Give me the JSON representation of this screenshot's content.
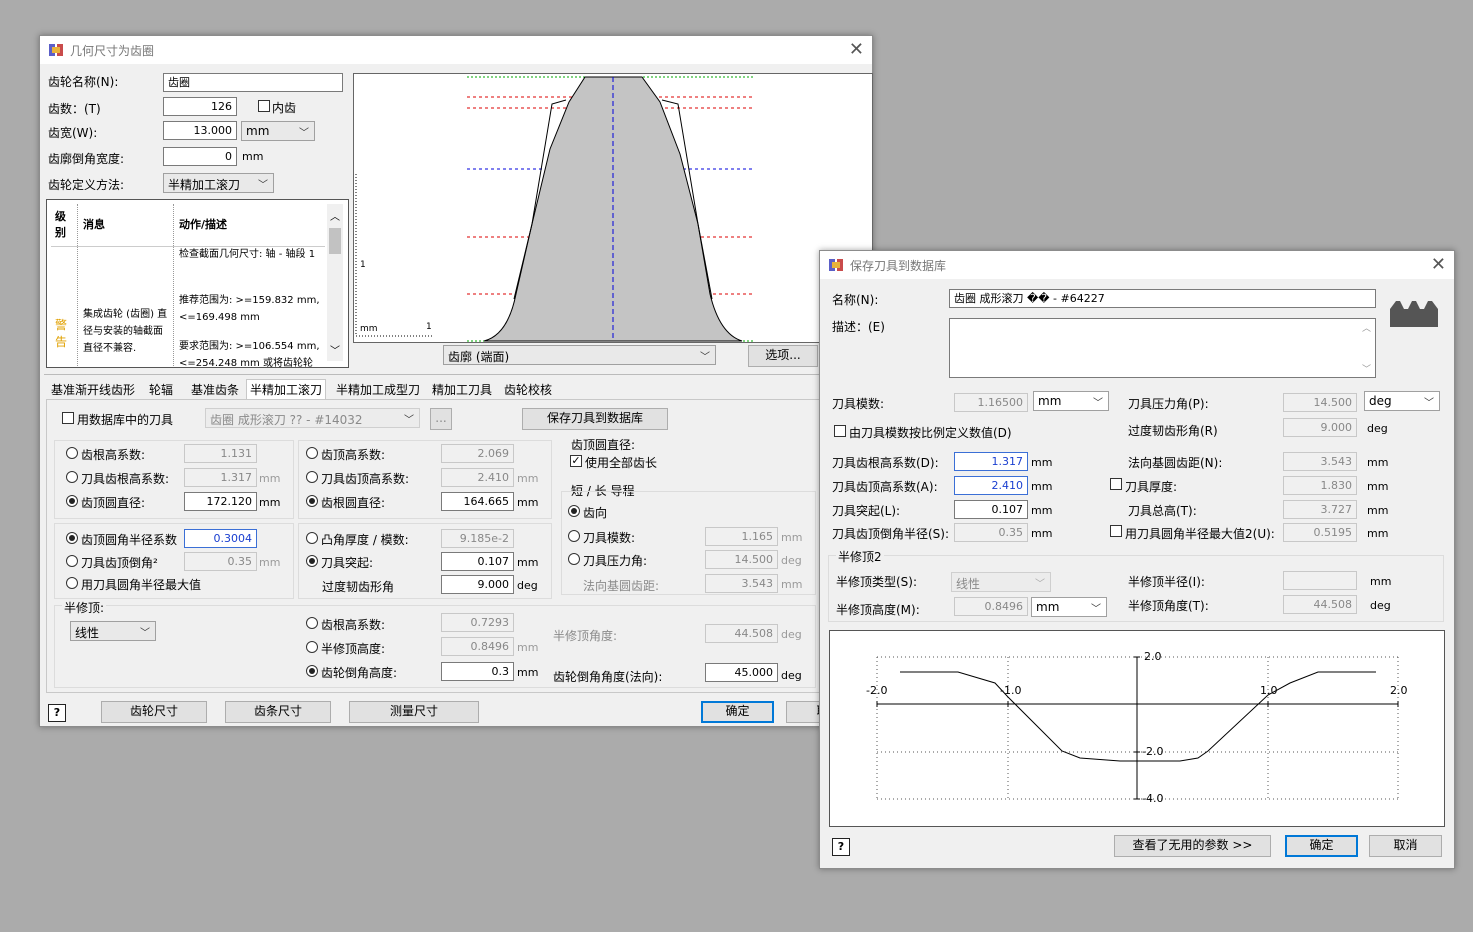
{
  "left": {
    "title": "几何尺寸为齿圈",
    "gear_name_label": "齿轮名称(N):",
    "gear_name": "齿圈",
    "teeth_label": "齿数：(T)",
    "teeth": "126",
    "internal_label": "内齿",
    "face_label": "齿宽(W):",
    "face": "13.000",
    "face_unit": "mm",
    "chamfer_label": "齿廓倒角宽度:",
    "chamfer": "0",
    "chamfer_unit": "mm",
    "method_label": "齿轮定义方法:",
    "method": "半精加工滚刀",
    "msg_headers": [
      "级别",
      "消息",
      "动作/描述"
    ],
    "msg_level": "警告",
    "msg_text": "集成齿轮 (齿圈) 直径与安装的轴截面直径不兼容.",
    "msg_action": [
      "检查截面几何尺寸: 轴 - 轴段 1",
      "推荐范围为: >=159.832 mm, <=169.498 mm",
      "要求范围为: >=106.554 mm, <=254.248 mm 或将齿轮轮"
    ],
    "plot": {
      "mm_label": "mm",
      "one_y": "1",
      "one_x": "1"
    },
    "view_select": "齿廓 (端面)",
    "options_btn": "选项...",
    "tabs": [
      "基准渐开线齿形",
      "轮辐",
      "基准齿条",
      "半精加工滚刀",
      "半精加工成型刀",
      "精加工刀具",
      "齿轮校核"
    ],
    "use_db_tool": "用数据库中的刀具",
    "db_tool": "齿圈 成形滚刀 ?? - #14032",
    "ellipsis": "...",
    "save_tool_btn": "保存刀具到数据库",
    "c1": {
      "r1": "齿根高系数:",
      "v1": "1.131",
      "r2": "刀具齿根高系数:",
      "v2": "1.317",
      "u2": "mm",
      "r3": "齿顶圆直径:",
      "v3": "172.120",
      "u3": "mm"
    },
    "c2": {
      "r1": "齿顶高系数:",
      "v1": "2.069",
      "r2": "刀具齿顶高系数:",
      "v2": "2.410",
      "u2": "mm",
      "r3": "齿根圆直径:",
      "v3": "164.665",
      "u3": "mm"
    },
    "c3": {
      "title": "齿顶圆直径:",
      "chk": "使用全部齿长",
      "g2": "短 / 长 导程",
      "r1": "齿向",
      "r2": "刀具模数:",
      "v2": "1.165",
      "u2": "mm",
      "r3": "刀具压力角:",
      "v3": "14.500",
      "u3": "deg",
      "l4": "法向基圆齿距:",
      "v4": "3.543",
      "u4": "mm"
    },
    "c4": {
      "r1": "齿顶圆角半径系数",
      "v1": "0.3004",
      "r2": "刀具齿顶倒角²",
      "v2": "0.35",
      "u2": "mm",
      "r3": "用刀具圆角半径最大值"
    },
    "c5": {
      "r1": "凸角厚度 / 模数:",
      "v1": "9.185e-2",
      "r2": "刀具突起:",
      "v2": "0.107",
      "u2": "mm",
      "l3": "过度韧齿形角",
      "v3": "9.000",
      "u3": "deg"
    },
    "semi_top": {
      "label": "半修顶:",
      "type": "线性",
      "r1": "齿根高系数:",
      "v1": "0.7293",
      "r2": "半修顶高度:",
      "v2": "0.8496",
      "u2": "mm",
      "r3": "齿轮倒角高度:",
      "v3": "0.3",
      "u3": "mm",
      "angle_label": "半修顶角度:",
      "angle": "44.508",
      "angle_unit": "deg",
      "chamfer_angle_label": "齿轮倒角角度(法向):",
      "chamfer_angle": "45.000",
      "chamfer_angle_unit": "deg"
    },
    "bottom": {
      "help": "?",
      "b1": "齿轮尺寸",
      "b2": "齿条尺寸",
      "b3": "测量尺寸",
      "ok": "确定",
      "cancel": "取"
    }
  },
  "right": {
    "title": "保存刀具到数据库",
    "name_label": "名称(N):",
    "name": "齿圈 成形滚刀 �� - #64227",
    "desc_label": "描述：(E)",
    "module_label": "刀具模数:",
    "module": "1.16500",
    "module_unit": "mm",
    "pa_label": "刀具压力角(P):",
    "pa": "14.500",
    "pa_unit": "deg",
    "chk_module": "由刀具模数按比例定义数值(D)",
    "trans_label": "过度韧齿形角(R)",
    "trans": "9.000",
    "trans_unit": "deg",
    "rows": [
      {
        "l": "刀具齿根高系数(D):",
        "v": "1.317",
        "u": "mm",
        "r": "法向基圆齿距(N):",
        "rv": "3.543",
        "ru": "mm"
      },
      {
        "l": "刀具齿顶高系数(A):",
        "v": "2.410",
        "u": "mm",
        "r": "刀具厚度:",
        "rv": "1.830",
        "ru": "mm"
      },
      {
        "l": "刀具突起(L):",
        "v": "0.107",
        "u": "mm",
        "r": "刀具总高(T):",
        "rv": "3.727",
        "ru": "mm"
      },
      {
        "l": "刀具齿顶倒角半径(S):",
        "v": "0.35",
        "u": "mm",
        "r": "用刀具圆角半径最大值2(U):",
        "rv": "0.5195",
        "ru": "mm"
      }
    ],
    "semi_group": "半修顶2",
    "semi_type_label": "半修顶类型(S):",
    "semi_type": "线性",
    "semi_r_label": "半修顶半径(I):",
    "semi_r": "",
    "semi_r_unit": "mm",
    "semi_h_label": "半修顶高度(M):",
    "semi_h": "0.8496",
    "semi_h_unit": "mm",
    "semi_a_label": "半修顶角度(T):",
    "semi_a": "44.508",
    "semi_a_unit": "deg",
    "chart_ticks": {
      "x_m2": "-2.0",
      "x_m1": "-1.0",
      "x_1": "1.0",
      "x_2": "2.0",
      "y_2": "2.0",
      "y_m2": "-2.0",
      "y_m4": "-4.0"
    },
    "help": "?",
    "unused_btn": "查看了无用的参数 >>",
    "ok": "确定",
    "cancel": "取消"
  }
}
